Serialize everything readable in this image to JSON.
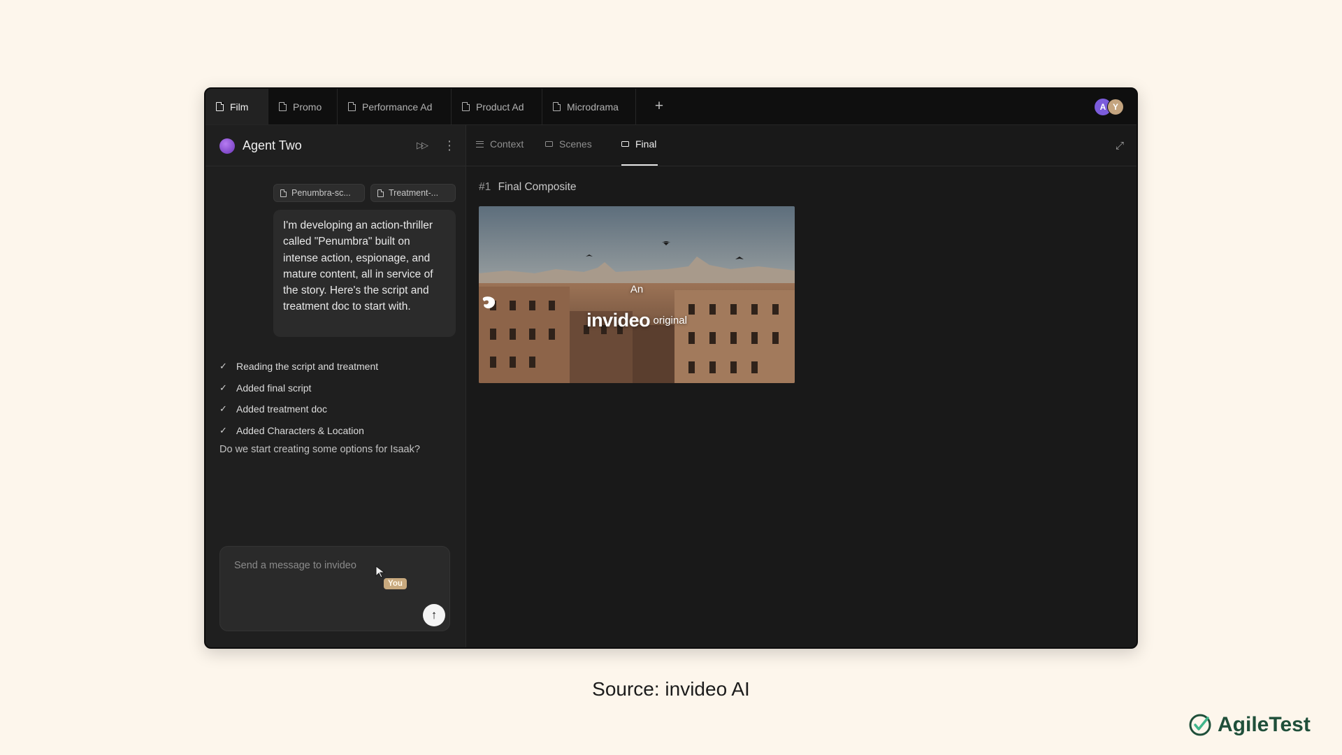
{
  "tabs": [
    {
      "label": "Film",
      "active": true
    },
    {
      "label": "Promo"
    },
    {
      "label": "Performance Ad"
    },
    {
      "label": "Product Ad"
    },
    {
      "label": "Microdrama"
    }
  ],
  "add_tab_label": "+",
  "avatars": [
    "A",
    "Y"
  ],
  "agent": {
    "name": "Agent Two"
  },
  "attachments": [
    "Penumbra-sc...",
    "Treatment-..."
  ],
  "user_message": "I'm developing an action-thriller called \"Penumbra\" built on intense action, espionage, and mature content, all in service of the story. Here's the script and treatment doc to start with.",
  "steps": [
    "Reading the script and treatment",
    "Added final script",
    "Added treatment doc",
    "Added Characters & Location"
  ],
  "agent_question": "Do we start creating some options for Isaak?",
  "composer": {
    "placeholder": "Send a message to invideo",
    "cursor_label": "You"
  },
  "view_tabs": [
    {
      "label": "Context",
      "icon": "list-icon"
    },
    {
      "label": "Scenes",
      "icon": "folder-icon"
    },
    {
      "label": "Final",
      "icon": "folder-icon",
      "active": true
    }
  ],
  "final": {
    "number": "#1",
    "title": "Final Composite",
    "overlay": {
      "prefix": "An",
      "logo": "invideo",
      "suffix": "original"
    }
  },
  "source_caption": "Source: invideo AI",
  "brand": {
    "name": "AgileTest",
    "color": "#1f4f3a"
  },
  "colors": {
    "background": "#fdf6ec",
    "accent_purple": "#7b5cdb",
    "cursor_badge": "#c8a97e"
  }
}
